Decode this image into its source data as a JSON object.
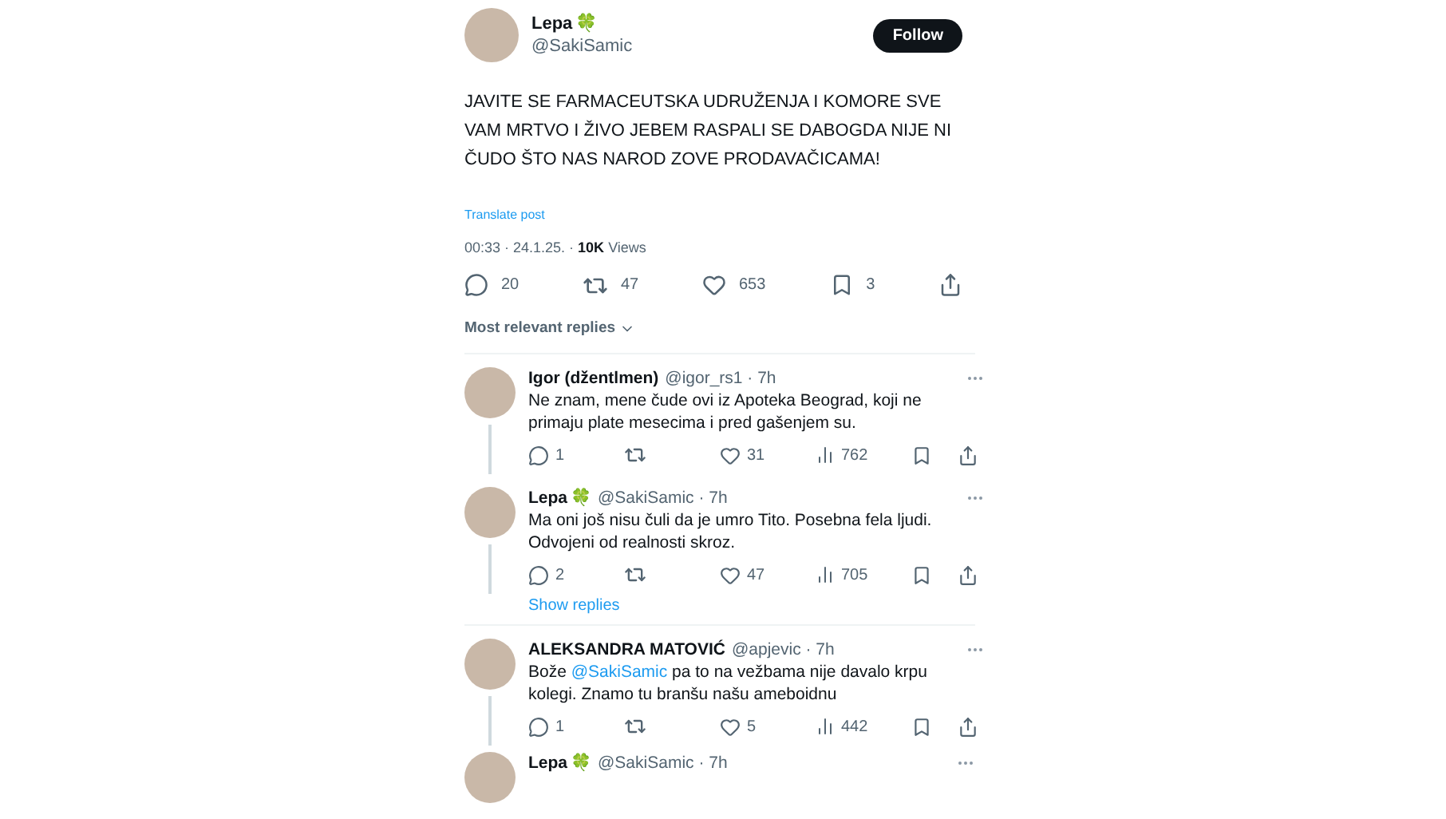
{
  "post": {
    "author": {
      "name": "Lepa",
      "emoji": "🍀",
      "handle": "@SakiSamic"
    },
    "follow_button": "Follow",
    "text": "JAVITE SE FARMACEUTSKA UDRUŽENJA I KOMORE SVE VAM MRTVO I ŽIVO JEBEM RASPALI SE DABOGDA NIJE NI ČUDO ŠTO NAS NAROD ZOVE PRODAVAČICAMA!",
    "translate": "Translate post",
    "time": "00:33 · 24.1.25. · ",
    "views_count": "10K",
    "views_label": " Views",
    "stats": {
      "replies": "20",
      "reposts": "47",
      "likes": "653",
      "bookmarks": "3"
    }
  },
  "replies_sort": "Most relevant replies",
  "replies": [
    {
      "name": "Igor (džentlmen)",
      "handle": "@igor_rs1 · 7h",
      "parts": [
        {
          "kind": "text",
          "text": "Ne znam, mene čude ovi iz Apoteka Beograd, koji ne primaju plate mesecima i pred gašenjem su."
        }
      ],
      "stats": {
        "replies": "1",
        "likes": "31",
        "views": "762"
      }
    },
    {
      "name": "Lepa",
      "emoji": "🍀",
      "handle": "@SakiSamic · 7h",
      "parts": [
        {
          "kind": "text",
          "text": "Ma oni još nisu čuli da je umro Tito. Posebna fela ljudi. Odvojeni od realnosti skroz."
        }
      ],
      "stats": {
        "replies": "2",
        "likes": "47",
        "views": "705"
      },
      "show_replies": "Show replies"
    },
    {
      "name": "ALEKSANDRA MATOVIĆ",
      "handle": "@apjevic · 7h",
      "parts": [
        {
          "kind": "text",
          "text": "Bože "
        },
        {
          "kind": "mention",
          "text": "@SakiSamic"
        },
        {
          "kind": "text",
          "text": " pa to na vežbama nije davalo krpu kolegi. Znamo tu branšu našu ameboidnu"
        }
      ],
      "stats": {
        "replies": "1",
        "likes": "5",
        "views": "442"
      }
    },
    {
      "name": "Lepa",
      "emoji": "🍀",
      "handle": "@SakiSamic · 7h"
    }
  ]
}
